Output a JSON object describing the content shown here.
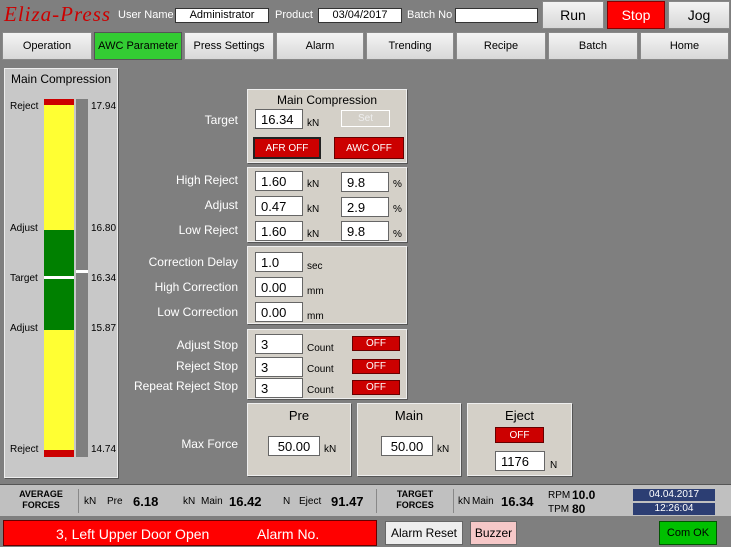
{
  "header": {
    "logo": "Eliza-Press",
    "user_label": "User Name",
    "user_value": "Administrator",
    "product_label": "Product",
    "product_value": "03/04/2017",
    "batch_label": "Batch No",
    "batch_value": "",
    "run": "Run",
    "stop": "Stop",
    "jog": "Jog"
  },
  "nav": [
    "Operation",
    "AWC Parameter",
    "Press Settings",
    "Alarm",
    "Trending",
    "Recipe",
    "Batch",
    "Home"
  ],
  "gauge": {
    "title": "Main Compression",
    "reject_top": "Reject",
    "reject_top_val": "17.94",
    "adjust_top": "Adjust",
    "adjust_top_val": "16.80",
    "target": "Target",
    "target_val": "16.34",
    "adjust_bot": "Adjust",
    "adjust_bot_val": "15.87",
    "reject_bot": "Reject",
    "reject_bot_val": "14.74"
  },
  "mc": {
    "title": "Main Compression",
    "target_label": "Target",
    "target_val": "16.34",
    "kn": "kN",
    "set": "Set",
    "afr": "AFR OFF",
    "awc": "AWC OFF"
  },
  "limits": {
    "high_reject": "High Reject",
    "hr_val": "1.60",
    "hr_pct": "9.8",
    "adjust": "Adjust",
    "adj_val": "0.47",
    "adj_pct": "2.9",
    "low_reject": "Low Reject",
    "lr_val": "1.60",
    "lr_pct": "9.8",
    "kn": "kN",
    "pct": "%"
  },
  "corr": {
    "delay": "Correction Delay",
    "delay_val": "1.0",
    "sec": "sec",
    "high": "High Correction",
    "high_val": "0.00",
    "low": "Low Correction",
    "low_val": "0.00",
    "mm": "mm"
  },
  "stops": {
    "adjust": "Adjust Stop",
    "adjust_val": "3",
    "reject": "Reject Stop",
    "reject_val": "3",
    "repeat": "Repeat Reject Stop",
    "repeat_val": "3",
    "count": "Count",
    "off": "OFF"
  },
  "maxforce": {
    "label": "Max Force",
    "pre": "Pre",
    "pre_val": "50.00",
    "main": "Main",
    "main_val": "50.00",
    "eject": "Eject",
    "eject_off": "OFF",
    "eject_val": "1176",
    "kn": "kN",
    "n": "N"
  },
  "status": {
    "avg": "AVERAGE FORCES",
    "kn": "kN",
    "n": "N",
    "pre": "Pre",
    "pre_val": "6.18",
    "main": "Main",
    "main_val": "16.42",
    "eject": "Eject",
    "eject_val": "91.47",
    "target": "TARGET FORCES",
    "t_main": "Main",
    "t_main_val": "16.34",
    "rpm": "RPM",
    "rpm_val": "10.0",
    "tpm": "TPM",
    "tpm_val": "80",
    "date": "04.04.2017",
    "time": "12:26:04"
  },
  "footer": {
    "alarm": "3, Left Upper Door Open",
    "alarm_no": "Alarm No.",
    "reset": "Alarm Reset",
    "buzzer": "Buzzer",
    "com": "Com OK"
  },
  "colors": {
    "red": "#cc0000",
    "green": "#33cc33",
    "yellow": "#ffff33",
    "gauge_green": "#008000"
  }
}
